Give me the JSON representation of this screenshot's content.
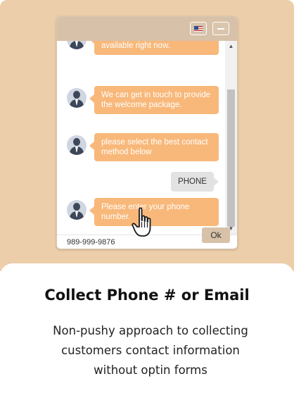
{
  "widget": {
    "header": {
      "language_icon": "us-flag-icon",
      "minimize_icon": "minimize-icon"
    },
    "messages": [
      {
        "from": "agent",
        "text": "Our live agents are not available right now."
      },
      {
        "from": "agent",
        "text": "We can get in touch to provide the welcome package."
      },
      {
        "from": "agent",
        "text": "please select the best contact method below"
      },
      {
        "from": "user",
        "text": "PHONE"
      },
      {
        "from": "agent",
        "text": "Please enter your phone number."
      }
    ],
    "input": {
      "value": "989-999-9876"
    },
    "ok_label": "Ok"
  },
  "feature": {
    "title": "Collect Phone # or Email",
    "description": "Non-pushy approach to collecting customers contact information without optin forms"
  },
  "colors": {
    "background": "#edceaa",
    "header": "#d7c1a8",
    "agent_bubble": "#f8b87a",
    "user_bubble": "#e2e2e2",
    "ok_button": "#d7c1a8"
  }
}
